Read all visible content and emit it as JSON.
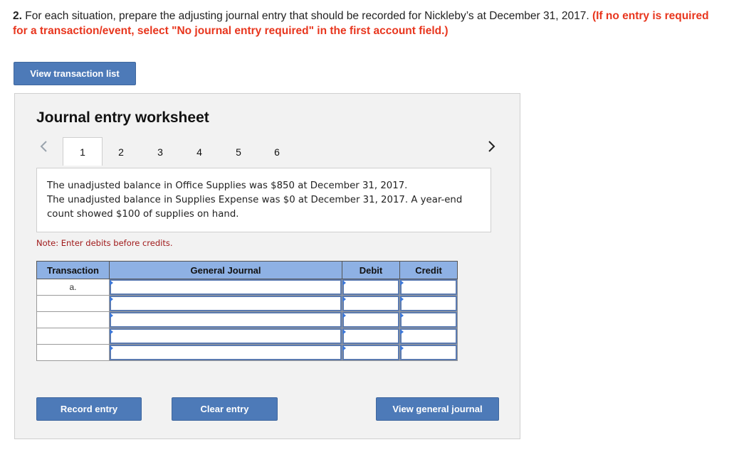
{
  "instructions": {
    "number": "2.",
    "text": " For each situation, prepare the adjusting journal entry that should be recorded for Nickleby’s at December 31, 2017. ",
    "highlight": "(If no entry is required for a transaction/event, select \"No journal entry required\" in the first account field.)"
  },
  "view_transaction_list_label": "View transaction list",
  "worksheet": {
    "title": "Journal entry worksheet",
    "tabs": [
      "1",
      "2",
      "3",
      "4",
      "5",
      "6"
    ],
    "active_tab": "1",
    "description_line1": "The unadjusted balance in Office Supplies was $850 at December 31, 2017.",
    "description_line2": "The unadjusted balance in Supplies Expense was $0 at December 31, 2017. A year-end count showed $100 of supplies on hand.",
    "note": "Note: Enter debits before credits.",
    "table": {
      "headers": [
        "Transaction",
        "General Journal",
        "Debit",
        "Credit"
      ],
      "rows": [
        {
          "transaction": "a."
        },
        {
          "transaction": ""
        },
        {
          "transaction": ""
        },
        {
          "transaction": ""
        },
        {
          "transaction": ""
        }
      ]
    },
    "record_entry_label": "Record entry",
    "clear_entry_label": "Clear entry",
    "view_general_journal_label": "View general journal"
  },
  "colors": {
    "button": "#4d7ab8",
    "header": "#8eb1e4",
    "instruction_highlight": "#e8361e",
    "note": "#a0191a"
  },
  "icons": {
    "prev": "chevron-left-icon",
    "next": "chevron-right-icon"
  }
}
